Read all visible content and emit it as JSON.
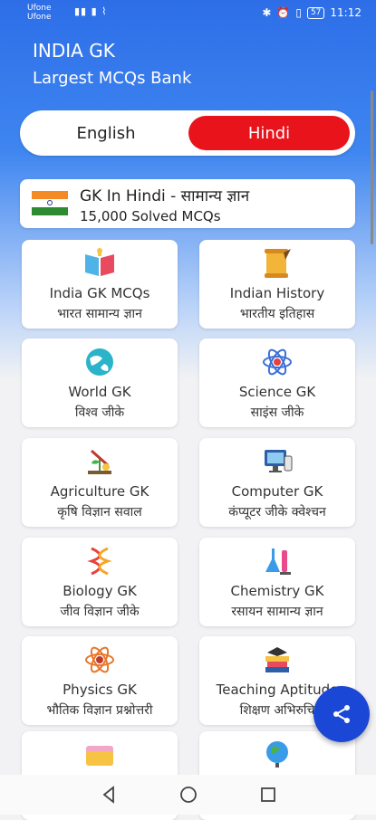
{
  "status_bar": {
    "carrier_1": "Ufone",
    "carrier_2": "Ufone",
    "battery": "57",
    "time": "11:12"
  },
  "header": {
    "title": "INDIA GK",
    "subtitle": "Largest MCQs Bank"
  },
  "language": {
    "english": "English",
    "hindi": "Hindi",
    "selected": "Hindi"
  },
  "banner": {
    "title": "GK In Hindi - सामान्य ज्ञान",
    "subtitle": "15,000 Solved MCQs",
    "icon": "india-flag"
  },
  "cards": [
    {
      "en": "India GK MCQs",
      "hi": "भारत सामान्य ज्ञान",
      "icon": "book-icon"
    },
    {
      "en": "Indian History",
      "hi": "भारतीय इतिहास",
      "icon": "scroll-icon"
    },
    {
      "en": "World GK",
      "hi": "विश्व जीके",
      "icon": "globe-icon"
    },
    {
      "en": "Science GK",
      "hi": "साइंस जीके",
      "icon": "atom-icon"
    },
    {
      "en": "Agriculture GK",
      "hi": "कृषि विज्ञान सवाल",
      "icon": "plant-icon"
    },
    {
      "en": "Computer GK",
      "hi": "कंप्यूटर जीके क्वेश्चन",
      "icon": "computer-icon"
    },
    {
      "en": "Biology GK",
      "hi": "जीव विज्ञान जीके",
      "icon": "dna-icon"
    },
    {
      "en": "Chemistry GK",
      "hi": "रसायन सामान्य ज्ञान",
      "icon": "flask-icon"
    },
    {
      "en": "Physics GK",
      "hi": "भौतिक विज्ञान प्रश्नोत्तरी",
      "icon": "physics-icon"
    },
    {
      "en": "Teaching Aptitude",
      "hi": "शिक्षण अभिरुचि",
      "icon": "books-icon"
    },
    {
      "en": "",
      "hi": "",
      "icon": "folder-icon"
    },
    {
      "en": "",
      "hi": "",
      "icon": "earth-globe-icon"
    }
  ],
  "fab": {
    "icon": "share-icon"
  },
  "colors": {
    "header_blue": "#2d6ee8",
    "selected_red": "#e8131b",
    "fab_blue": "#1a47d6"
  }
}
